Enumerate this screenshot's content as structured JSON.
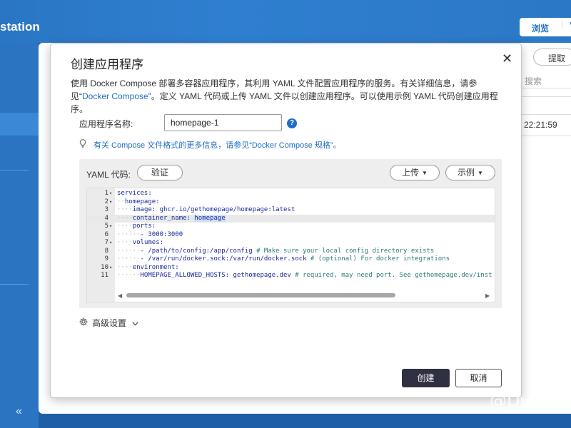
{
  "background": {
    "app_title": "station",
    "browse_button": "浏览",
    "fetch_button": "提取",
    "search_placeholder": "搜索",
    "timestamp": "22:21:59",
    "collapse_glyph": "«"
  },
  "dialog": {
    "title": "创建应用程序",
    "close_glyph": "✕",
    "description_part1": "使用 Docker Compose 部署多容器应用程序，其利用 YAML 文件配置应用程序的服务。有关详细信息，请参见“",
    "description_link": "Docker Compose",
    "description_part2": "”。定义 YAML 代码或上传 YAML 文件以创建应用程序。可以使用示例 YAML 代码创建应用程序。",
    "app_name_label": "应用程序名称:",
    "app_name_value": "homepage-1",
    "help_glyph": "?",
    "info_text": "有关 Compose 文件格式的更多信息，请参见“Docker Compose 规格”。",
    "yaml_label": "YAML 代码:",
    "validate_button": "验证",
    "upload_button": "上传",
    "example_button": "示例",
    "advanced_settings": "高级设置",
    "create_button": "创建",
    "cancel_button": "取消"
  },
  "code_lines": [
    {
      "num": "1",
      "fold": "▾",
      "text": "services:"
    },
    {
      "num": "2",
      "fold": "▾",
      "text": "··homepage:"
    },
    {
      "num": "3",
      "fold": "",
      "text": "····image: ghcr.io/gethomepage/homepage:latest"
    },
    {
      "num": "4",
      "fold": "",
      "text": "····container_name: homepage"
    },
    {
      "num": "5",
      "fold": "▾",
      "text": "····ports:"
    },
    {
      "num": "6",
      "fold": "",
      "text": "······- 3000:3000"
    },
    {
      "num": "7",
      "fold": "▾",
      "text": "····volumes:"
    },
    {
      "num": "8",
      "fold": "",
      "text": "······- /path/to/config:/app/config # Make sure your local config directory exists"
    },
    {
      "num": "9",
      "fold": "",
      "text": "······- /var/run/docker.sock:/var/run/docker.sock # (optional) For docker integrations"
    },
    {
      "num": "10",
      "fold": "▾",
      "text": "····environment:"
    },
    {
      "num": "11",
      "fold": "",
      "text": "······HOMEPAGE_ALLOWED_HOSTS: gethomepage.dev # required, may need port. See gethomepage.dev/inst"
    }
  ],
  "active_line": 4,
  "watermark": "@Dylan"
}
